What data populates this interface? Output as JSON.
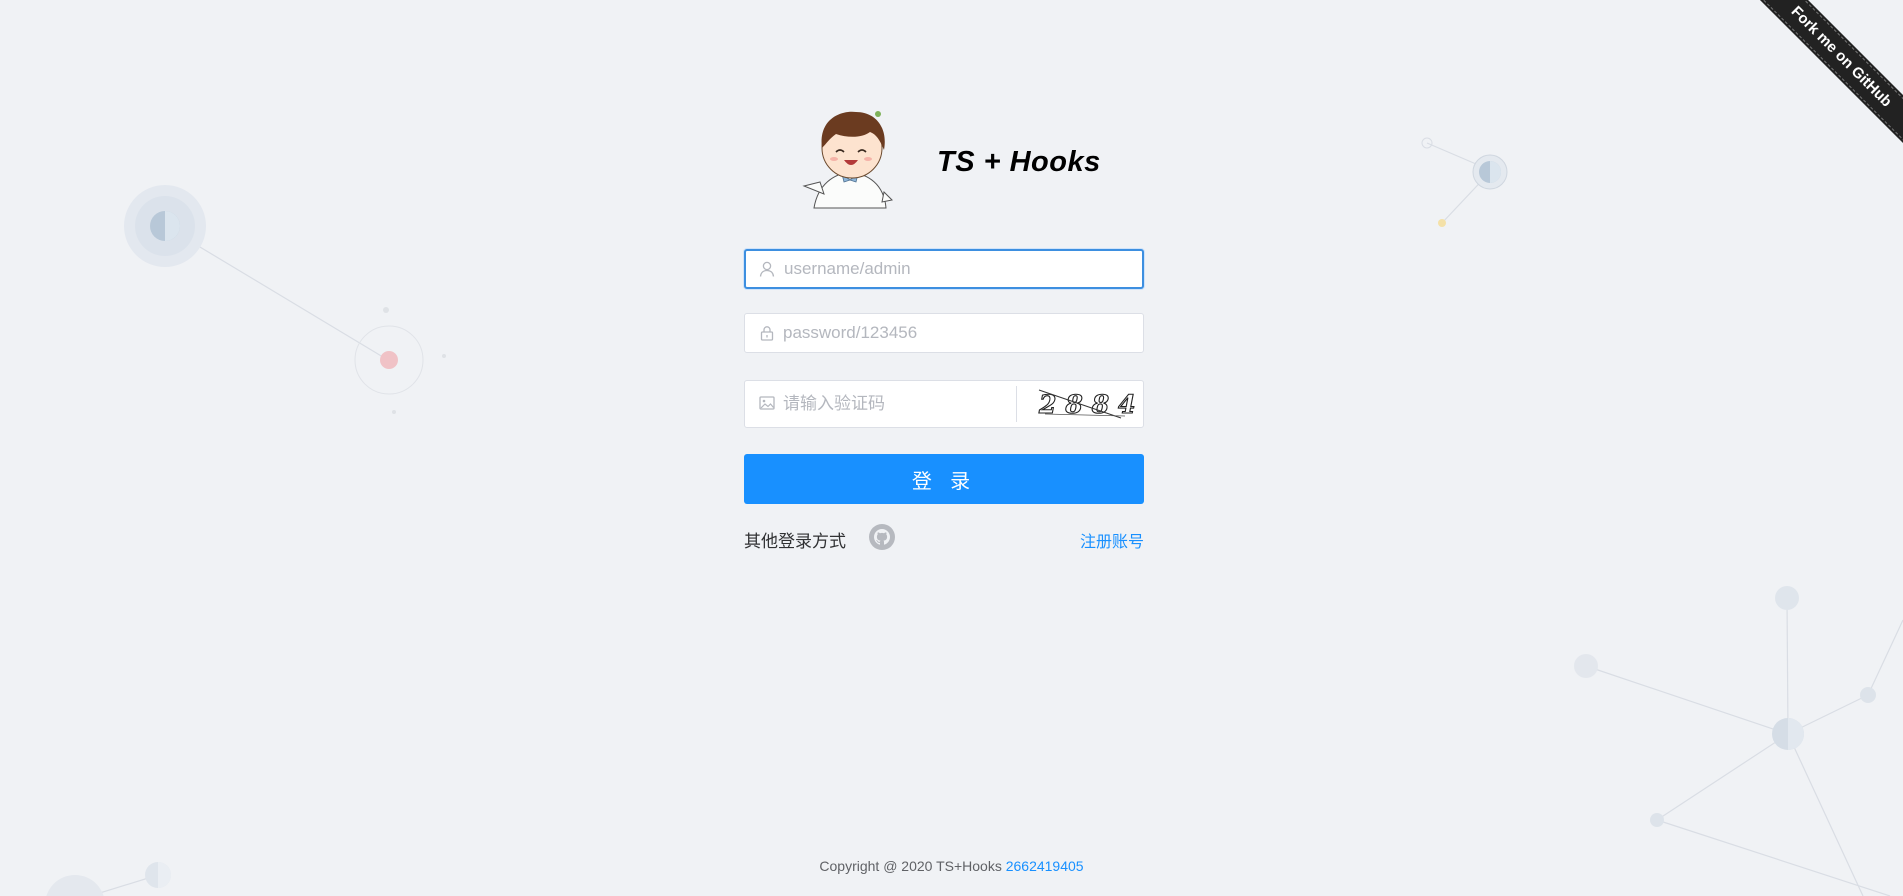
{
  "brand": {
    "title": "TS + Hooks"
  },
  "form": {
    "username": {
      "placeholder": "username/admin",
      "value": ""
    },
    "password": {
      "placeholder": "password/123456",
      "value": ""
    },
    "captcha": {
      "placeholder": "请输入验证码",
      "value": "",
      "image_text": "2884"
    },
    "login_label": "登 录",
    "other_login_label": "其他登录方式",
    "register_label": "注册账号"
  },
  "footer": {
    "text": "Copyright @ 2020 TS+Hooks",
    "link": "2662419405"
  },
  "ribbon": {
    "label": "Fork me on GitHub"
  },
  "icons": {
    "username": "user-icon",
    "password": "lock-icon",
    "captcha": "image-icon",
    "github": "github-icon"
  },
  "colors": {
    "primary": "#1890ff",
    "background": "#f0f2f5",
    "ribbon": "#222222"
  }
}
